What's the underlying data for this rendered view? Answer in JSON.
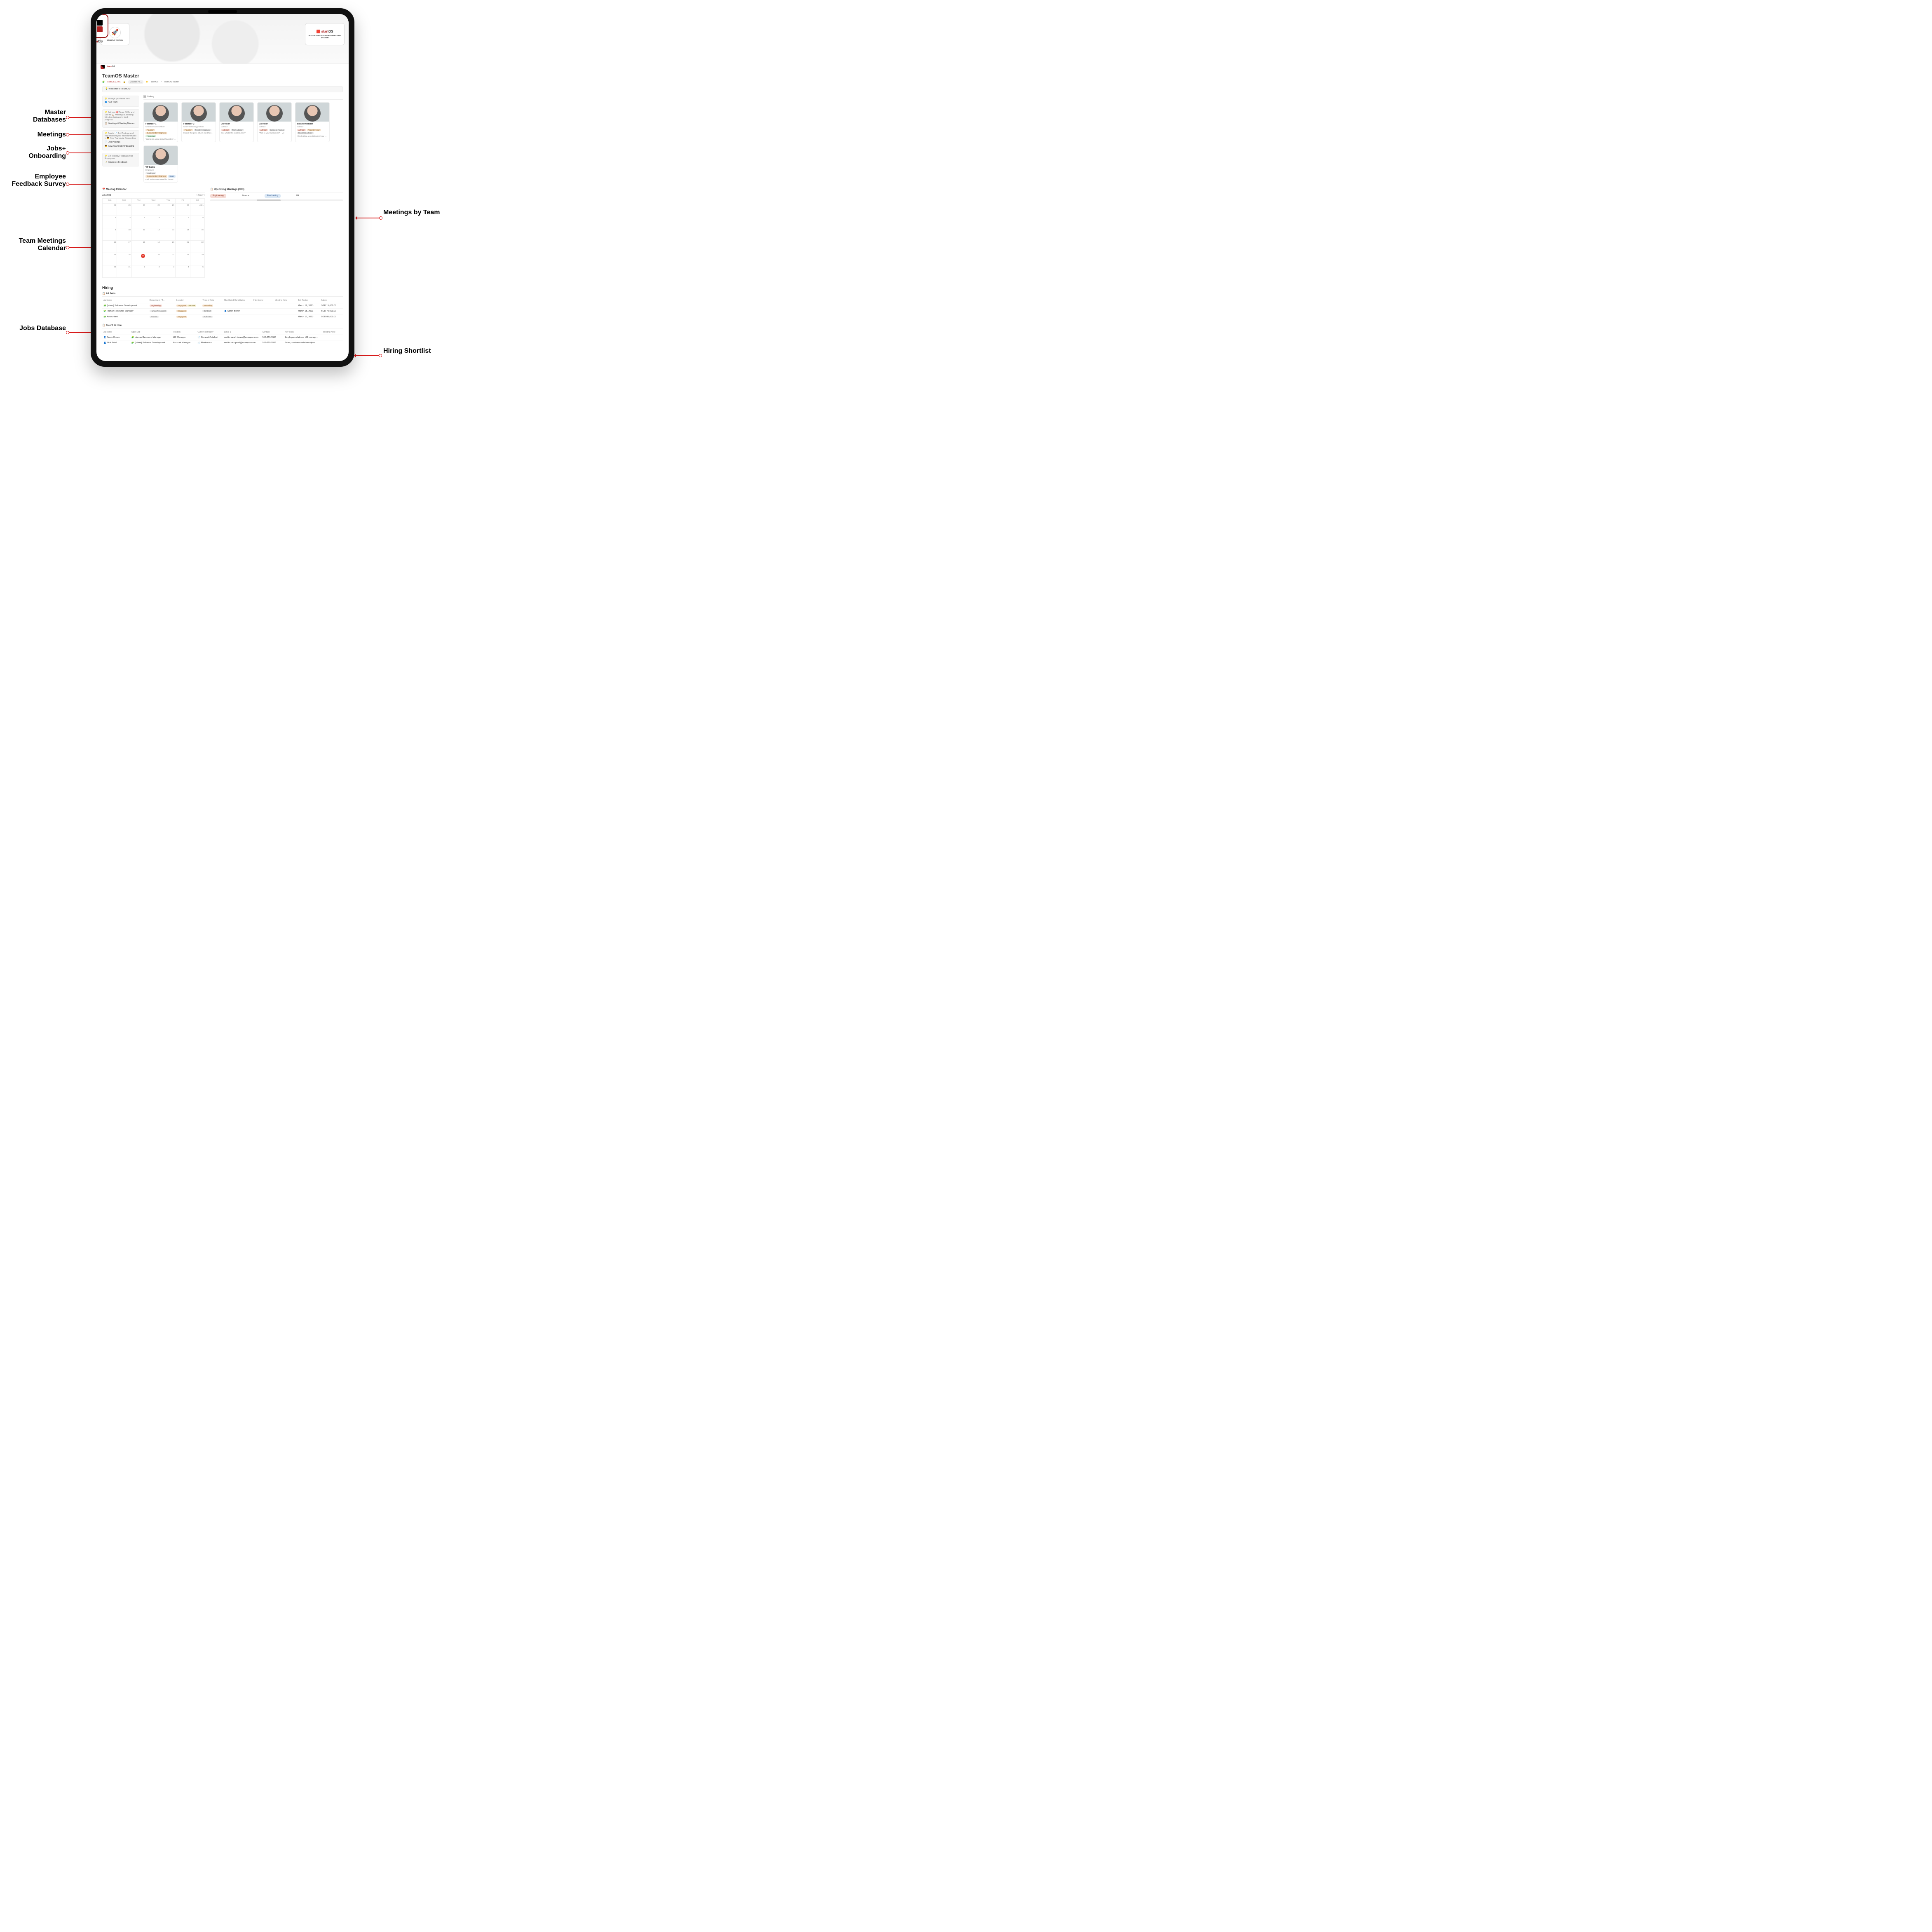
{
  "annotations": {
    "left": [
      "Master\nDatabases",
      "Meetings",
      "Jobs+\nOnboarding",
      "Employee\nFeedback\nSurvey",
      "Team\nMeetings\nCalendar",
      "Jobs\nDatabase"
    ],
    "right": [
      "Meetings by\nTeam",
      "Hiring\nShortlist"
    ]
  },
  "hero": {
    "left_label": "STARTUP NOTION",
    "center_brand": "teamOS",
    "right_brand": "startOS",
    "right_sub": "INTEGRATED STARTUP\nOPERATING SYSTEM",
    "crumb": "teamOS"
  },
  "page": {
    "title": "TeamOS Master",
    "crumbs": [
      "StartOS v.2.01",
      "(Access Pa...",
      "StartOS",
      "TeamOS Master"
    ],
    "welcome": "Welcome to TeamOS!"
  },
  "sidecards": [
    {
      "lead": "Manage your team here!",
      "links": [
        {
          "ico": "👥",
          "label": "Our Team"
        }
      ]
    },
    {
      "lead": "Set your 🎯 Team OKRs and use the 📋 Meetings & Meeting Minutes database to track progress.",
      "links": [
        {
          "ico": "📋",
          "label": "Meetings & Meeting Minutes"
        }
      ]
    },
    {
      "lead": "Create 📄 Job Postings and help onboard your new teammates in 🧑 New Teammate Onboarding.",
      "links": [
        {
          "ico": "📄",
          "label": "Job Postings"
        },
        {
          "ico": "🧑",
          "label": "New Teammate Onboarding"
        }
      ]
    },
    {
      "lead": "Get Monthly Feedback from Employees",
      "links": [
        {
          "ico": "📝",
          "label": "Employee Feedback"
        }
      ]
    }
  ],
  "gallery": {
    "label": "Gallery",
    "cards": [
      {
        "name": "Founder 1",
        "role": "Chief Executive Officer",
        "tags": [
          {
            "t": "Founder",
            "c": "orange"
          },
          {
            "t": "Customer Development",
            "c": "orange"
          },
          {
            "t": "Financials",
            "c": "green"
          }
        ],
        "note": "Talk to me about something other than money..."
      },
      {
        "name": "Founder 2",
        "role": "Chief Technology Officer",
        "tags": [
          {
            "t": "Founder",
            "c": "orange"
          },
          {
            "t": "Tech Development",
            "c": "grey"
          }
        ],
        "note": "I break things so others don't have to."
      },
      {
        "name": "Advisor",
        "role": "Advisor",
        "tags": [
          {
            "t": "Advisor",
            "c": "red"
          },
          {
            "t": "Tech Advisor",
            "c": "grey"
          }
        ],
        "note": "So, what's the problem now?"
      },
      {
        "name": "Advisor",
        "role": "Advisor",
        "tags": [
          {
            "t": "Advisor",
            "c": "red"
          },
          {
            "t": "Business Advisor",
            "c": "grey"
          }
        ],
        "note": "\"Talk to your customers!\" - Me"
      },
      {
        "name": "Board Member",
        "role": "Advisor",
        "tags": [
          {
            "t": "Advisor",
            "c": "red"
          },
          {
            "t": "Angel Investor",
            "c": "orange"
          },
          {
            "t": "Business Advisor",
            "c": "grey"
          }
        ],
        "note": "This felt like a cool idea to throw money at"
      },
      {
        "name": "VP Sales",
        "role": "Employee",
        "tags": [
          {
            "t": "Employee",
            "c": "grey"
          },
          {
            "t": "Customer Development",
            "c": "orange"
          },
          {
            "t": "Sales",
            "c": "blue"
          }
        ],
        "note": "I talk to the customers like the Advisor says"
      }
    ]
  },
  "calendar": {
    "title": "Meeting Calendar",
    "month": "July 2023",
    "today_label": "Today",
    "days": [
      "Sun",
      "Mon",
      "Tue",
      "Wed",
      "Thu",
      "Fri",
      "Sat"
    ],
    "grid": [
      [
        "25",
        "26",
        "27",
        "28",
        "29",
        "30",
        "Jul 1"
      ],
      [
        "2",
        "3",
        "4",
        "5",
        "6",
        "7",
        "8"
      ],
      [
        "9",
        "10",
        "11",
        "12",
        "13",
        "14",
        "15"
      ],
      [
        "16",
        "17",
        "18",
        "19",
        "20",
        "21",
        "22"
      ],
      [
        "23",
        "24",
        "25",
        "26",
        "27",
        "28",
        "29"
      ],
      [
        "30",
        "31",
        "1",
        "2",
        "3",
        "4",
        "5"
      ]
    ],
    "today": "25"
  },
  "upcoming": {
    "title": "Upcoming Meetings (30D)",
    "chips": [
      {
        "t": "Engineering",
        "c": "red"
      },
      {
        "t": "Finance",
        "c": "txt"
      },
      {
        "t": "Fundraising",
        "c": "blue"
      },
      {
        "t": "HR",
        "c": "txt"
      }
    ]
  },
  "hiring": {
    "title": "Hiring",
    "jobs_tab": "All Jobs",
    "columns": [
      "Aa Name",
      "Department / T...",
      "Location",
      "Type of Role",
      "Shortlisted Candidates",
      "Interviewer",
      "Meeting Note",
      "Job Posted",
      "Salary"
    ],
    "rows": [
      {
        "name": "(Intern) Software Development",
        "dept": {
          "t": "Engineering",
          "c": "red"
        },
        "loc1": {
          "t": "Singapore",
          "c": "orange"
        },
        "loc2": {
          "t": "Remote",
          "c": "yellow"
        },
        "type": {
          "t": "Internship",
          "c": "orange"
        },
        "cand": "",
        "posted": "March 19, 2023",
        "salary": "SGD 15,000.00"
      },
      {
        "name": "Human Resource Manager",
        "dept": {
          "t": "Human Resources",
          "c": "grey"
        },
        "loc1": {
          "t": "Singapore",
          "c": "orange"
        },
        "type": {
          "t": "Contract",
          "c": "grey"
        },
        "cand": "Sarah Brown",
        "posted": "March 18, 2023",
        "salary": "SGD 70,000.00"
      },
      {
        "name": "Accountant",
        "dept": {
          "t": "Finance",
          "c": "grey"
        },
        "loc1": {
          "t": "Singapore",
          "c": "orange"
        },
        "type": {
          "t": "Full-Time",
          "c": "grey"
        },
        "cand": "",
        "posted": "March 17, 2023",
        "salary": "SGD 85,000.00"
      }
    ],
    "talent_tab": "Talent to Hire",
    "talent_cols": [
      "Aa Name",
      "Open Job",
      "Position",
      "Current company",
      "Email 1",
      "Contact",
      "Key Skills",
      "Meeting Note"
    ],
    "talent": [
      {
        "name": "Sarah Brown",
        "job": "Human Resource Manager",
        "pos": "HR Manager",
        "co": "General Catalyst",
        "email": "mailto:sarah.brown@example.com",
        "phone": "555-555-5555",
        "skills": "Employee relations, HR manag…"
      },
      {
        "name": "Nick Patel",
        "job": "(Intern) Software Development",
        "pos": "Account Manager",
        "co": "Flextronics",
        "email": "mailto:nick.patel@example.com",
        "phone": "555-555-5555",
        "skills": "Sales, customer relationship m…"
      }
    ]
  }
}
